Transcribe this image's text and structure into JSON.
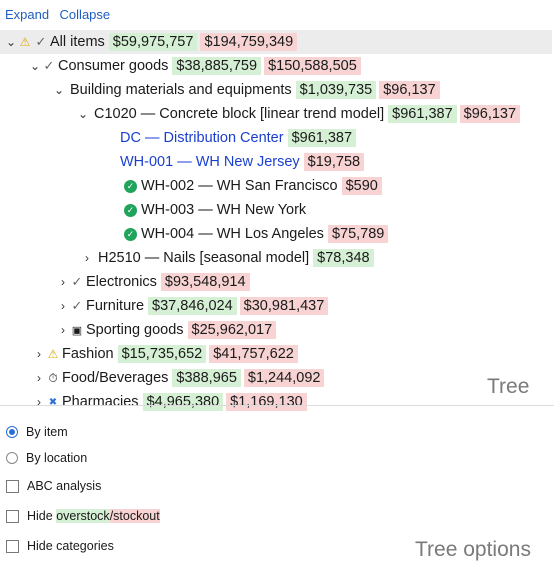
{
  "toolbar": {
    "expand": "Expand",
    "collapse": "Collapse"
  },
  "tree": {
    "panel_title": "Tree",
    "rows": [
      {
        "label": "All items",
        "green": "$59,975,757",
        "red": "$194,759,349"
      },
      {
        "label": "Consumer goods",
        "green": "$38,885,759",
        "red": "$150,588,505"
      },
      {
        "label": "Building materials and equipments",
        "green": "$1,039,735",
        "red": "$96,137"
      },
      {
        "label": "C1020 — Concrete block [linear trend model]",
        "green": "$961,387",
        "red": "$96,137"
      },
      {
        "label": "DC — Distribution Center",
        "green": "$961,387"
      },
      {
        "label": "WH-001 — WH New Jersey",
        "red": "$19,758"
      },
      {
        "label": "WH-002 — WH San Francisco",
        "red": "$590"
      },
      {
        "label": "WH-003 — WH New York"
      },
      {
        "label": "WH-004 — WH Los Angeles",
        "red": "$75,789"
      },
      {
        "label": "H2510 — Nails [seasonal model]",
        "green": "$78,348"
      },
      {
        "label": "Electronics",
        "red": "$93,548,914"
      },
      {
        "label": "Furniture",
        "green": "$37,846,024",
        "red": "$30,981,437"
      },
      {
        "label": "Sporting goods",
        "red": "$25,962,017"
      },
      {
        "label": "Fashion",
        "green": "$15,735,652",
        "red": "$41,757,622"
      },
      {
        "label": "Food/Beverages",
        "green": "$388,965",
        "red": "$1,244,092"
      },
      {
        "label": "Pharmacies",
        "green": "$4,965,380",
        "red": "$1,169,130"
      }
    ]
  },
  "options": {
    "panel_title": "Tree options",
    "by_item": "By item",
    "by_location": "By location",
    "abc": "ABC analysis",
    "hide_prefix": "Hide ",
    "hide_overstock": "overstock",
    "hide_sep": "/",
    "hide_stockout": "stockout",
    "hide_categories": "Hide categories"
  }
}
